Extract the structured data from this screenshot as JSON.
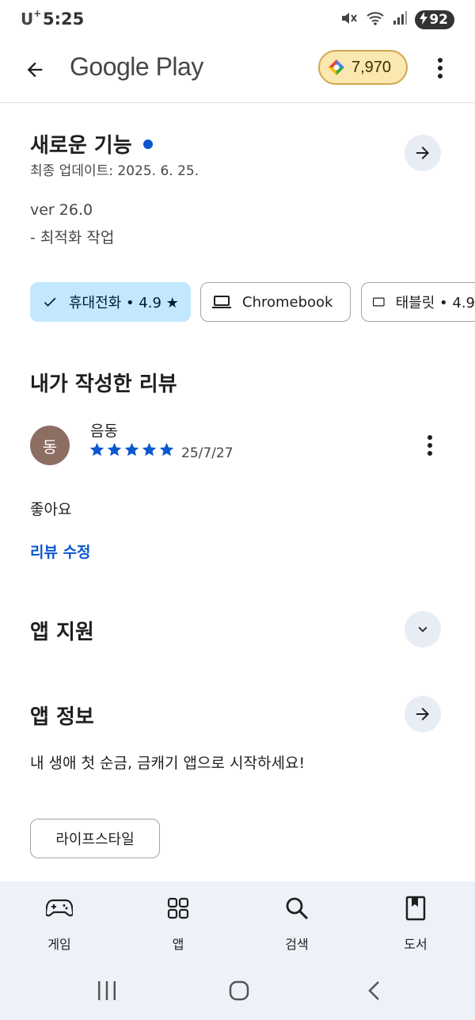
{
  "status_bar": {
    "carrier": "U",
    "carrier_sup": "+",
    "time": "5:25",
    "battery": "92"
  },
  "app_bar": {
    "title": "Google Play",
    "points": "7,970"
  },
  "whats_new": {
    "title": "새로운 기능",
    "last_updated": "최종 업데이트: 2025. 6. 25.",
    "version": "ver 26.0",
    "note": "- 최적화 작업"
  },
  "device_chips": [
    {
      "label": "휴대전화 • 4.9 ★",
      "icon": "check-icon",
      "selected": true
    },
    {
      "label": "Chromebook",
      "icon": "laptop-icon",
      "selected": false
    },
    {
      "label": "태블릿 • 4.9",
      "icon": "tablet-icon",
      "selected": false
    }
  ],
  "my_review": {
    "title": "내가 작성한 리뷰",
    "avatar_initial": "동",
    "reviewer": "음동",
    "rating": 5,
    "date": "25/7/27",
    "text": "좋아요",
    "edit_label": "리뷰 수정"
  },
  "app_support": {
    "title": "앱 지원"
  },
  "app_info": {
    "title": "앱 정보",
    "description": "내 생애 첫 순금, 금캐기 앱으로 시작하세요!",
    "tag": "라이프스타일"
  },
  "bottom_nav": [
    {
      "label": "게임",
      "icon": "gamepad-icon"
    },
    {
      "label": "앱",
      "icon": "apps-grid-icon"
    },
    {
      "label": "검색",
      "icon": "search-icon"
    },
    {
      "label": "도서",
      "icon": "book-icon"
    }
  ],
  "colors": {
    "accent": "#0b57d0",
    "selected_chip": "#c2e7ff",
    "nav_bg": "#eef1f8",
    "points_chip": "#fbe7b0"
  }
}
